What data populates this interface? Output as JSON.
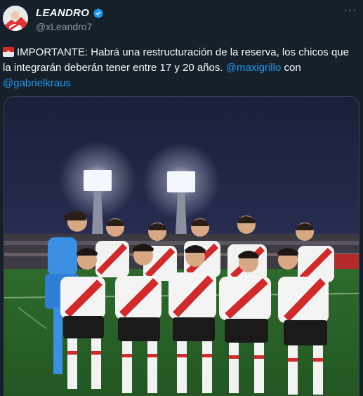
{
  "author": {
    "display_name": "LEANDRO",
    "handle": "@xLeandro7",
    "verified": true
  },
  "icons": {
    "more": "more-dots-icon",
    "verified": "verified-badge-icon",
    "emoji": "flag-emoji-icon"
  },
  "tweet": {
    "text_prefix": "IMPORTANTE: Habrá una restructuración de la reserva, los chicos que la integrarán deberán tener entre 17 y 20 años.",
    "mention_1": "@maxigrillo",
    "connector": "con",
    "mention_2": "@gabrielkraus"
  },
  "colors": {
    "background": "#15202b",
    "link": "#1d9bf0",
    "verified": "#1d9bf0",
    "secondary_text": "#8b98a5"
  }
}
